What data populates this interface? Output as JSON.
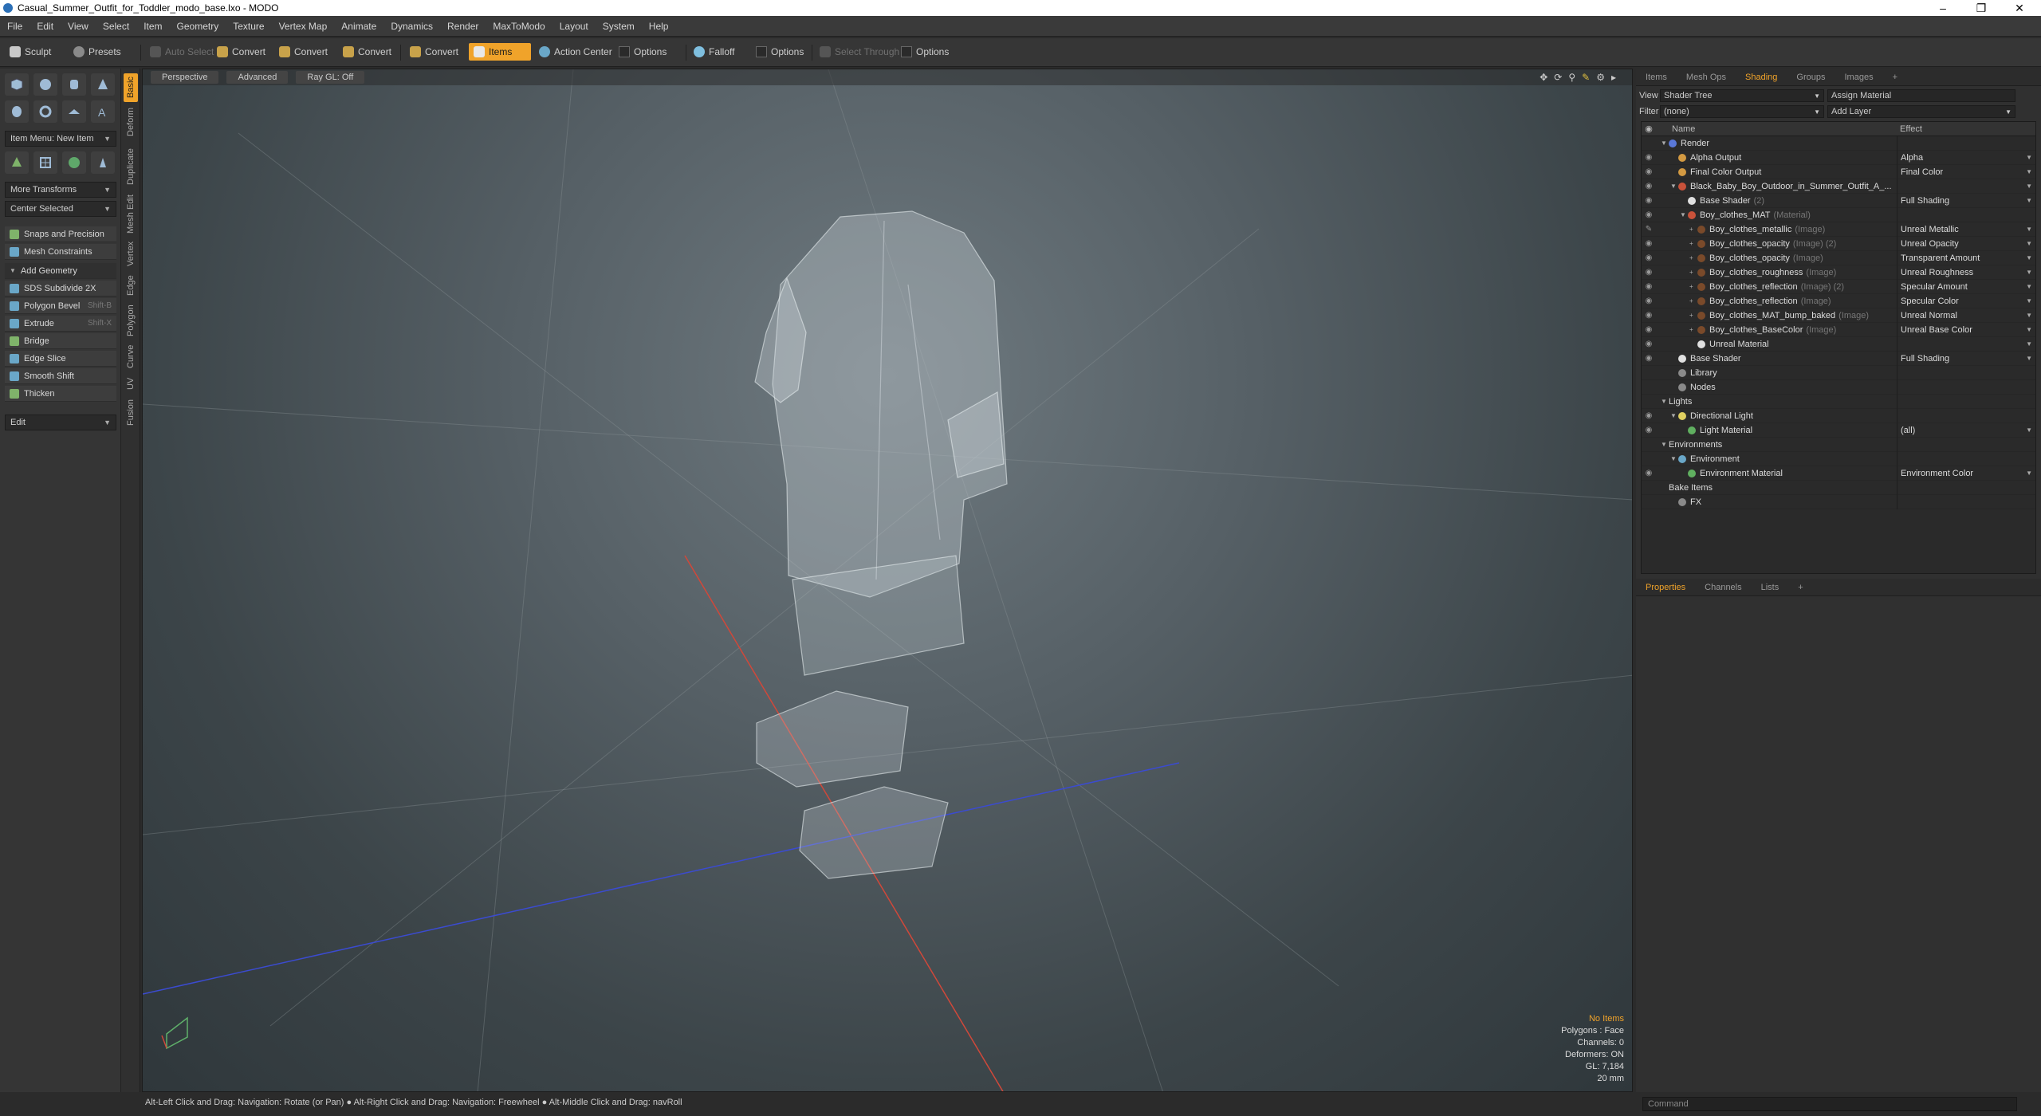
{
  "window": {
    "title": "Casual_Summer_Outfit_for_Toddler_modo_base.lxo - MODO"
  },
  "menu": [
    "File",
    "Edit",
    "View",
    "Select",
    "Item",
    "Geometry",
    "Texture",
    "Vertex Map",
    "Animate",
    "Dynamics",
    "Render",
    "MaxToModo",
    "Layout",
    "System",
    "Help"
  ],
  "toolbar": {
    "sculpt": "Sculpt",
    "presets": "Presets",
    "auto_select": "Auto Select",
    "convert1": "Convert",
    "convert2": "Convert",
    "convert3": "Convert",
    "convert4": "Convert",
    "items": "Items",
    "action_center": "Action Center",
    "options1": "Options",
    "falloff": "Falloff",
    "options2": "Options",
    "select_through": "Select Through",
    "options3": "Options"
  },
  "left": {
    "item_menu": "Item Menu: New Item",
    "more_transforms": "More Transforms",
    "center_selected": "Center Selected",
    "snaps": "Snaps and Precision",
    "mesh_constraints": "Mesh Constraints",
    "add_geometry": "Add Geometry",
    "tools": [
      {
        "label": "SDS Subdivide 2X",
        "shortcut": ""
      },
      {
        "label": "Polygon Bevel",
        "shortcut": "Shift-B"
      },
      {
        "label": "Extrude",
        "shortcut": "Shift-X"
      },
      {
        "label": "Bridge",
        "shortcut": ""
      },
      {
        "label": "Edge Slice",
        "shortcut": ""
      },
      {
        "label": "Smooth Shift",
        "shortcut": ""
      },
      {
        "label": "Thicken",
        "shortcut": ""
      }
    ],
    "edit": "Edit"
  },
  "vtabs": [
    "Basic",
    "Deform",
    "Duplicate",
    "Mesh Edit",
    "Vertex",
    "Edge",
    "Polygon",
    "Curve",
    "UV",
    "Fusion"
  ],
  "viewport": {
    "tab_perspective": "Perspective",
    "tab_advanced": "Advanced",
    "tab_raygl": "Ray GL: Off",
    "stats": {
      "no_items": "No Items",
      "polygons": "Polygons : Face",
      "channels": "Channels: 0",
      "deformers": "Deformers: ON",
      "gl": "GL: 7,184",
      "size": "20 mm"
    }
  },
  "status": "Alt-Left Click and Drag: Navigation: Rotate (or Pan) ● Alt-Right Click and Drag: Navigation: Freewheel ● Alt-Middle Click and Drag: navRoll",
  "right": {
    "tabs": [
      "Items",
      "Mesh Ops",
      "Shading",
      "Groups",
      "Images",
      "+"
    ],
    "view_label": "View",
    "view_value": "Shader Tree",
    "assign_material": "Assign Material",
    "filter_label": "Filter",
    "filter_value": "(none)",
    "add_layer": "Add Layer",
    "col_name": "Name",
    "col_effect": "Effect",
    "rows": [
      {
        "eye": "",
        "indent": 0,
        "tw": "▼",
        "color": "#5a78d8",
        "name": "Render",
        "sub": "",
        "effect": "",
        "arr": ""
      },
      {
        "eye": "◉",
        "indent": 1,
        "tw": "",
        "color": "#d39a42",
        "name": "Alpha Output",
        "sub": "",
        "effect": "Alpha",
        "arr": "▼"
      },
      {
        "eye": "◉",
        "indent": 1,
        "tw": "",
        "color": "#d39a42",
        "name": "Final Color Output",
        "sub": "",
        "effect": "Final Color",
        "arr": "▼"
      },
      {
        "eye": "◉",
        "indent": 1,
        "tw": "▼",
        "color": "#c9523a",
        "name": "Black_Baby_Boy_Outdoor_in_Summer_Outfit_A_...",
        "sub": "",
        "effect": "",
        "arr": "▼"
      },
      {
        "eye": "◉",
        "indent": 2,
        "tw": "",
        "color": "#e0e0e0",
        "name": "Base Shader",
        "sub": "(2)",
        "effect": "Full Shading",
        "arr": "▼"
      },
      {
        "eye": "◉",
        "indent": 2,
        "tw": "▼",
        "color": "#c9523a",
        "name": "Boy_clothes_MAT",
        "sub": "(Material)",
        "effect": "",
        "arr": ""
      },
      {
        "eye": "✎",
        "indent": 3,
        "tw": "+",
        "color": "#7a4a2a",
        "name": "Boy_clothes_metallic",
        "sub": "(Image)",
        "effect": "Unreal Metallic",
        "arr": "▼"
      },
      {
        "eye": "◉",
        "indent": 3,
        "tw": "+",
        "color": "#7a4a2a",
        "name": "Boy_clothes_opacity",
        "sub": "(Image) (2)",
        "effect": "Unreal Opacity",
        "arr": "▼"
      },
      {
        "eye": "◉",
        "indent": 3,
        "tw": "+",
        "color": "#7a4a2a",
        "name": "Boy_clothes_opacity",
        "sub": "(Image)",
        "effect": "Transparent Amount",
        "arr": "▼"
      },
      {
        "eye": "◉",
        "indent": 3,
        "tw": "+",
        "color": "#7a4a2a",
        "name": "Boy_clothes_roughness",
        "sub": "(Image)",
        "effect": "Unreal Roughness",
        "arr": "▼"
      },
      {
        "eye": "◉",
        "indent": 3,
        "tw": "+",
        "color": "#7a4a2a",
        "name": "Boy_clothes_reflection",
        "sub": "(Image) (2)",
        "effect": "Specular Amount",
        "arr": "▼"
      },
      {
        "eye": "◉",
        "indent": 3,
        "tw": "+",
        "color": "#7a4a2a",
        "name": "Boy_clothes_reflection",
        "sub": "(Image)",
        "effect": "Specular Color",
        "arr": "▼"
      },
      {
        "eye": "◉",
        "indent": 3,
        "tw": "+",
        "color": "#7a4a2a",
        "name": "Boy_clothes_MAT_bump_baked",
        "sub": "(Image)",
        "effect": "Unreal Normal",
        "arr": "▼"
      },
      {
        "eye": "◉",
        "indent": 3,
        "tw": "+",
        "color": "#7a4a2a",
        "name": "Boy_clothes_BaseColor",
        "sub": "(Image)",
        "effect": "Unreal Base Color",
        "arr": "▼"
      },
      {
        "eye": "◉",
        "indent": 3,
        "tw": "",
        "color": "#e0e0e0",
        "name": "Unreal Material",
        "sub": "",
        "effect": "",
        "arr": "▼"
      },
      {
        "eye": "◉",
        "indent": 1,
        "tw": "",
        "color": "#e0e0e0",
        "name": "Base Shader",
        "sub": "",
        "effect": "Full Shading",
        "arr": "▼"
      },
      {
        "eye": "",
        "indent": 1,
        "tw": "",
        "color": "#8a8a8a",
        "name": "Library",
        "sub": "",
        "effect": "",
        "arr": ""
      },
      {
        "eye": "",
        "indent": 1,
        "tw": "",
        "color": "#8a8a8a",
        "name": "Nodes",
        "sub": "",
        "effect": "",
        "arr": ""
      },
      {
        "eye": "",
        "indent": 0,
        "tw": "▼",
        "color": "",
        "name": "Lights",
        "sub": "",
        "effect": "",
        "arr": ""
      },
      {
        "eye": "◉",
        "indent": 1,
        "tw": "▼",
        "color": "#e0d060",
        "name": "Directional Light",
        "sub": "",
        "effect": "",
        "arr": ""
      },
      {
        "eye": "◉",
        "indent": 2,
        "tw": "",
        "color": "#60b060",
        "name": "Light Material",
        "sub": "",
        "effect": "(all)",
        "arr": "▼"
      },
      {
        "eye": "",
        "indent": 0,
        "tw": "▼",
        "color": "",
        "name": "Environments",
        "sub": "",
        "effect": "",
        "arr": ""
      },
      {
        "eye": "",
        "indent": 1,
        "tw": "▼",
        "color": "#6aa7c8",
        "name": "Environment",
        "sub": "",
        "effect": "",
        "arr": ""
      },
      {
        "eye": "◉",
        "indent": 2,
        "tw": "",
        "color": "#60b060",
        "name": "Environment Material",
        "sub": "",
        "effect": "Environment Color",
        "arr": "▼"
      },
      {
        "eye": "",
        "indent": 0,
        "tw": "",
        "color": "",
        "name": "Bake Items",
        "sub": "",
        "effect": "",
        "arr": ""
      },
      {
        "eye": "",
        "indent": 1,
        "tw": "",
        "color": "#8a8a8a",
        "name": "FX",
        "sub": "",
        "effect": "",
        "arr": ""
      }
    ],
    "bottom_tabs": [
      "Properties",
      "Channels",
      "Lists",
      "+"
    ],
    "command_placeholder": "Command"
  },
  "colors": {
    "accent": "#f0a32a",
    "viewport_bg": "#566066",
    "panel": "#303030"
  }
}
